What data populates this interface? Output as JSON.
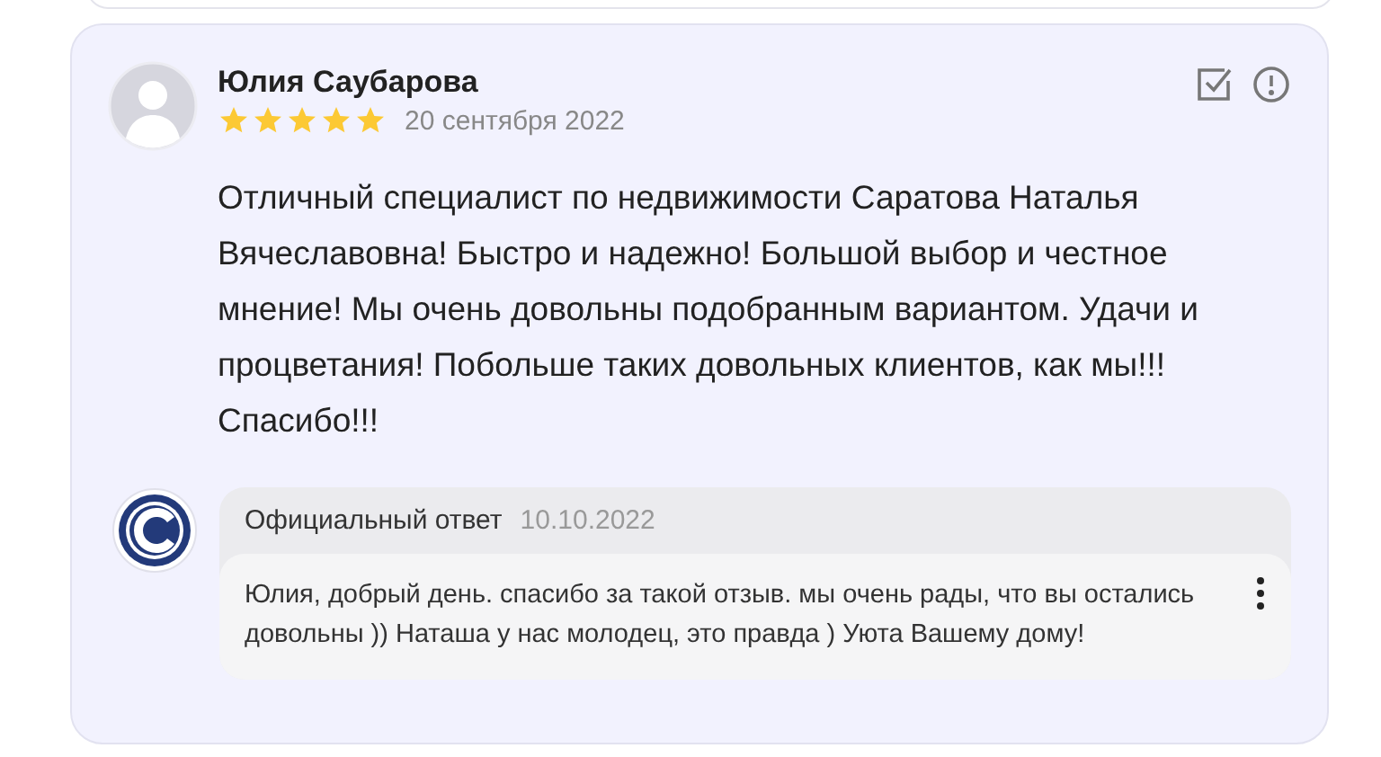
{
  "review": {
    "author": "Юлия Саубарова",
    "stars": 5,
    "date": "20 сентября 2022",
    "text": "Отличный специалист по недвижимости Саратова Наталья Вячеславовна! Быстро и надежно! Большой выбор и честное мнение! Мы очень довольны подобранным вариантом. Удачи и процветания! Побольше таких довольных клиентов, как мы!!! Спасибо!!!"
  },
  "reply": {
    "title": "Официальный ответ",
    "date": "10.10.2022",
    "text": "Юлия, добрый день. спасибо за такой отзыв. мы очень рады, что вы остались довольны )) Наташа у нас молодец, это правда ) Уюта Вашему дому!"
  }
}
